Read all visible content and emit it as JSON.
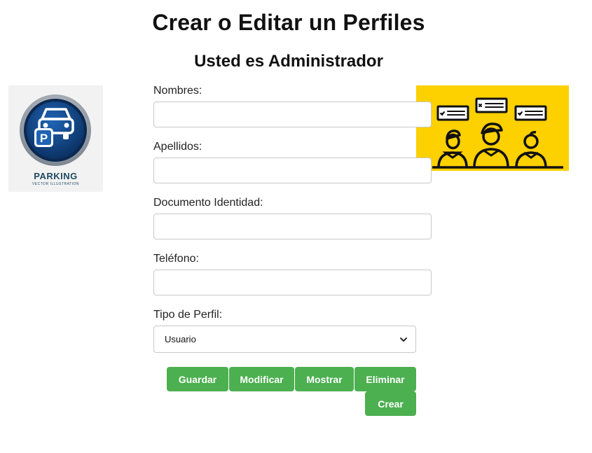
{
  "header": {
    "title": "Crear o Editar un Perfiles",
    "subtitle": "Usted es Administrador"
  },
  "logo": {
    "text": "PARKING",
    "subtext": "VECTOR ILLUSTRATION",
    "icon": "parking-car-icon",
    "colors": {
      "circle": "#0d3a73",
      "ring": "#9aa3ad",
      "text": "#1e4a63"
    }
  },
  "illustration": {
    "icon": "users-chat-icon",
    "colors": {
      "background": "#fdd000",
      "line": "#111111"
    }
  },
  "form": {
    "nombres_label": "Nombres:",
    "nombres_value": "",
    "apellidos_label": "Apellidos:",
    "apellidos_value": "",
    "documento_label": "Documento Identidad:",
    "documento_value": "",
    "telefono_label": "Teléfono:",
    "telefono_value": "",
    "tipo_label": "Tipo de Perfil:",
    "tipo_selected": "Usuario"
  },
  "buttons": {
    "guardar": "Guardar",
    "modificar": "Modificar",
    "mostrar": "Mostrar",
    "eliminar": "Eliminar",
    "crear": "Crear",
    "color": "#4caf50"
  }
}
